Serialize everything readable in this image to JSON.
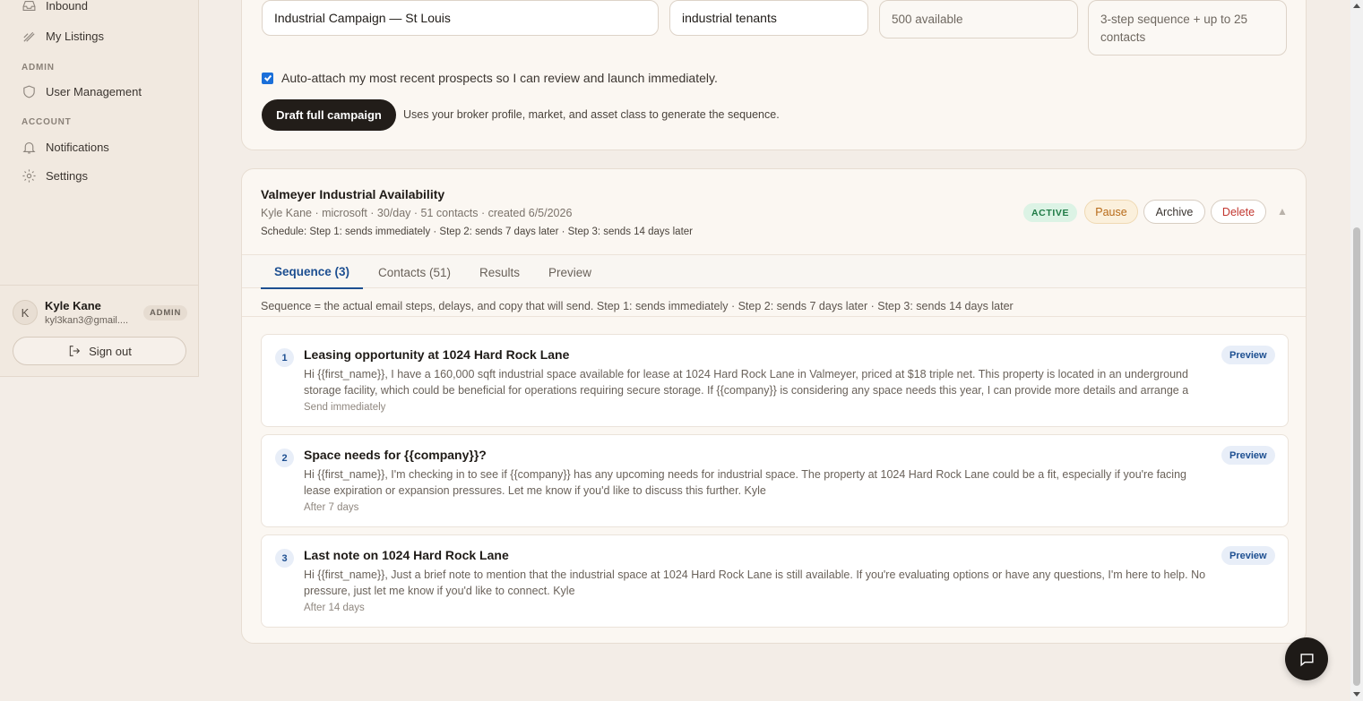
{
  "sidebar": {
    "items_top": [
      {
        "label": "Inbound",
        "icon": "inbox-icon"
      },
      {
        "label": "My Listings",
        "icon": "listings-icon"
      }
    ],
    "admin_section": "ADMIN",
    "admin_items": [
      {
        "label": "User Management",
        "icon": "shield-icon"
      }
    ],
    "account_section": "ACCOUNT",
    "account_items": [
      {
        "label": "Notifications",
        "icon": "bell-icon"
      },
      {
        "label": "Settings",
        "icon": "gear-icon"
      }
    ],
    "user": {
      "initial": "K",
      "name": "Kyle Kane",
      "email": "kyl3kan3@gmail....",
      "badge": "ADMIN"
    },
    "signout_label": "Sign out"
  },
  "compose": {
    "campaign_name": "Industrial Campaign — St Louis",
    "audience": "industrial tenants",
    "available": "500 available",
    "sequence_info": "3-step sequence + up to 25 contacts",
    "auto_attach_label": "Auto-attach my most recent prospects so I can review and launch immediately.",
    "auto_attach_checked": true,
    "draft_button": "Draft full campaign",
    "draft_hint": "Uses your broker profile, market, and asset class to generate the sequence."
  },
  "campaign": {
    "title": "Valmeyer Industrial Availability",
    "meta": "Kyle Kane · microsoft · 30/day · 51 contacts · created 6/5/2026",
    "schedule": "Schedule: Step 1: sends immediately · Step 2: sends 7 days later · Step 3: sends 14 days later",
    "status": "ACTIVE",
    "actions": {
      "pause": "Pause",
      "archive": "Archive",
      "delete": "Delete"
    },
    "tabs": [
      "Sequence (3)",
      "Contacts (51)",
      "Results",
      "Preview"
    ],
    "active_tab": 0,
    "sequence_note": "Sequence = the actual email steps, delays, and copy that will send. Step 1: sends immediately · Step 2: sends 7 days later · Step 3: sends 14 days later",
    "steps": [
      {
        "num": "1",
        "subject": "Leasing opportunity at 1024 Hard Rock Lane",
        "body": "Hi {{first_name}}, I have a 160,000 sqft industrial space available for lease at 1024 Hard Rock Lane in Valmeyer, priced at $18 triple net. This property is located in an underground storage facility, which could be beneficial for operations requiring secure storage. If {{company}} is considering any space needs this year, I can provide more details and arrange a",
        "delay": "Send immediately",
        "preview_label": "Preview"
      },
      {
        "num": "2",
        "subject": "Space needs for {{company}}?",
        "body": "Hi {{first_name}}, I'm checking in to see if {{company}} has any upcoming needs for industrial space. The property at 1024 Hard Rock Lane could be a fit, especially if you're facing lease expiration or expansion pressures. Let me know if you'd like to discuss this further. Kyle",
        "delay": "After 7 days",
        "preview_label": "Preview"
      },
      {
        "num": "3",
        "subject": "Last note on 1024 Hard Rock Lane",
        "body": "Hi {{first_name}}, Just a brief note to mention that the industrial space at 1024 Hard Rock Lane is still available. If you're evaluating options or have any questions, I'm here to help. No pressure, just let me know if you'd like to connect. Kyle",
        "delay": "After 14 days",
        "preview_label": "Preview"
      }
    ]
  },
  "colors": {
    "accent": "#1d4f91",
    "active_badge_bg": "#dcf3e5",
    "active_badge_text": "#1f7a45",
    "pause": "#b76a18",
    "delete": "#c2362f",
    "dark_button": "#221d19"
  }
}
